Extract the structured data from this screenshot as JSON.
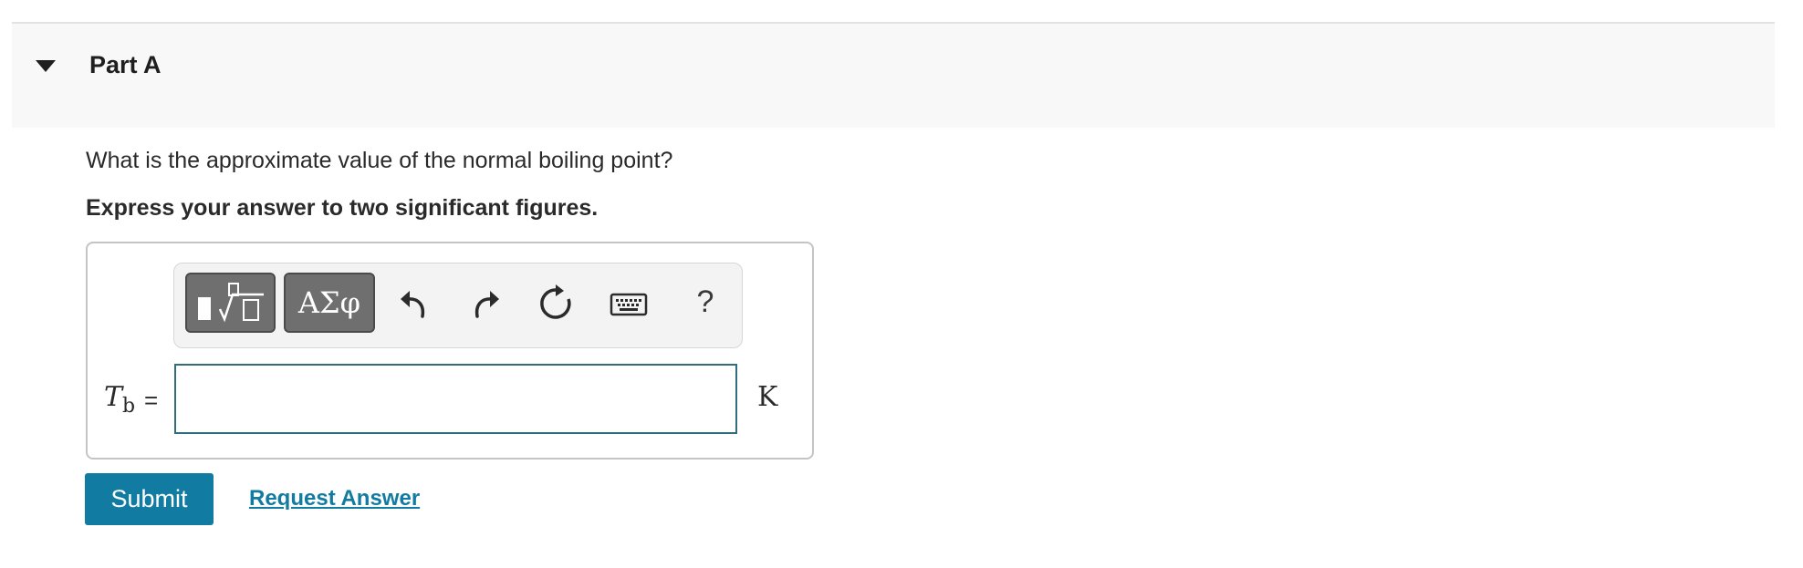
{
  "part": {
    "title": "Part A",
    "caret_icon": "caret-down-icon"
  },
  "question": {
    "text": "What is the approximate value of the normal boiling point?",
    "instruction": "Express your answer to two significant figures."
  },
  "toolbar": {
    "templates_icon": "math-templates-icon",
    "symbols_label": "ΑΣφ",
    "undo_icon": "undo-icon",
    "redo_icon": "redo-icon",
    "reset_icon": "reset-icon",
    "keyboard_icon": "keyboard-icon",
    "help_label": "?"
  },
  "answer": {
    "variable_symbol": "T",
    "variable_subscript": "b",
    "equals": "=",
    "value": "",
    "unit": "K"
  },
  "actions": {
    "submit_label": "Submit",
    "request_answer_label": "Request Answer"
  },
  "colors": {
    "accent": "#127ba1",
    "input_border": "#2f6f7a",
    "header_bg": "#f8f8f8"
  }
}
